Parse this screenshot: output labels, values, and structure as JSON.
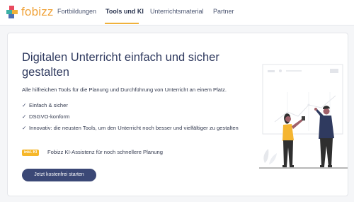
{
  "nav": {
    "logo_text": "fobizz",
    "items": [
      {
        "label": "Fortbildungen",
        "active": false
      },
      {
        "label": "Tools und KI",
        "active": true
      },
      {
        "label": "Unterrichtsmaterial",
        "active": false
      },
      {
        "label": "Partner",
        "active": false
      }
    ]
  },
  "hero": {
    "title": "Digitalen Unterricht einfach und sicher gestalten",
    "subtitle": "Alle hilfreichen Tools für die Planung und Durchführung von Unterricht an einem Platz.",
    "features": [
      "Einfach & sicher",
      "DSGVO-konform",
      "Innovativ: die neusten Tools, um den Unterricht noch besser und vielfältiger zu gestalten"
    ],
    "ki_badge": "inkl. KI",
    "ki_text": "Fobizz KI-Assistenz für noch schnellere Planung",
    "cta_label": "Jetzt kostenfrei starten"
  },
  "colors": {
    "accent": "#f0b13b",
    "primary": "#3b4876",
    "badge": "#f6b72a",
    "illustration_accent": "#f5b531",
    "illustration_dark": "#2f3a5f"
  },
  "icons": {
    "logo": "fobizz-logo-icon",
    "check": "check-icon",
    "illustration": "whiteboard-illustration"
  }
}
